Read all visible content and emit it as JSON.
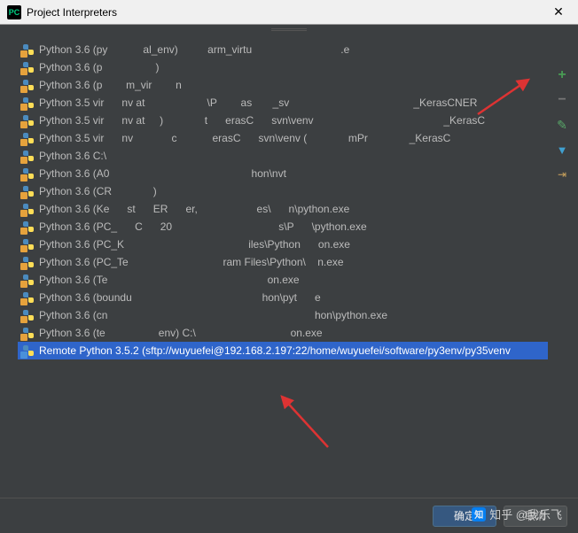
{
  "window": {
    "title": "Project Interpreters",
    "app_icon_label": "PC"
  },
  "toolbar": {
    "add": "+",
    "remove": "−",
    "edit": "✎",
    "filter": "▼",
    "expand": "⇥"
  },
  "interpreters": [
    {
      "label": "Python 3.6 (py      al_env)     arm_virtu               .e",
      "remote": false
    },
    {
      "label": "Python 3.6 (p         )",
      "remote": false
    },
    {
      "label": "Python 3.6 (p    m_vir    n",
      "remote": false
    },
    {
      "label": "Python 3.5 vir   nv at           \\P    as    _sv                     _KerasCNER",
      "remote": false
    },
    {
      "label": "Python 3.5 vir   nv at   )       t   erasC   svn\\venv                      _KerasC",
      "remote": false
    },
    {
      "label": "Python 3.5 vir   nv       c      erasC   svn\\venv (       mPr       _KerasC",
      "remote": false
    },
    {
      "label": "Python 3.6 C:\\                          ",
      "remote": false
    },
    {
      "label": "Python 3.6 (A0                        hon\\nvt   ",
      "remote": false
    },
    {
      "label": "Python 3.6 (CR       )                        ",
      "remote": false
    },
    {
      "label": "Python 3.6 (Ke   st   ER   er,          es\\   n\\python.exe",
      "remote": false
    },
    {
      "label": "Python 3.6 (PC_   C   20                  s\\P   \\python.exe",
      "remote": false
    },
    {
      "label": "Python 3.6 (PC_K                     iles\\Python   on.exe",
      "remote": false
    },
    {
      "label": "Python 3.6 (PC_Te                ram Files\\Python\\  n.exe",
      "remote": false
    },
    {
      "label": "Python 3.6 (Te                           on.exe",
      "remote": false
    },
    {
      "label": "Python 3.6 (boundu                      hon\\pyt   e",
      "remote": false
    },
    {
      "label": "Python 3.6 (cn                                   hon\\python.exe",
      "remote": false
    },
    {
      "label": "Python 3.6 (te         env) C:\\                on.exe",
      "remote": false
    },
    {
      "label": "Remote Python 3.5.2 (sftp://wuyuefei@192.168.2.197:22/home/wuyuefei/software/py3env/py35venv",
      "remote": true,
      "selected": true
    }
  ],
  "buttons": {
    "ok": "确定",
    "cancel": "取消"
  },
  "watermark": {
    "logo": "知",
    "text": "知乎 @我乐飞"
  }
}
